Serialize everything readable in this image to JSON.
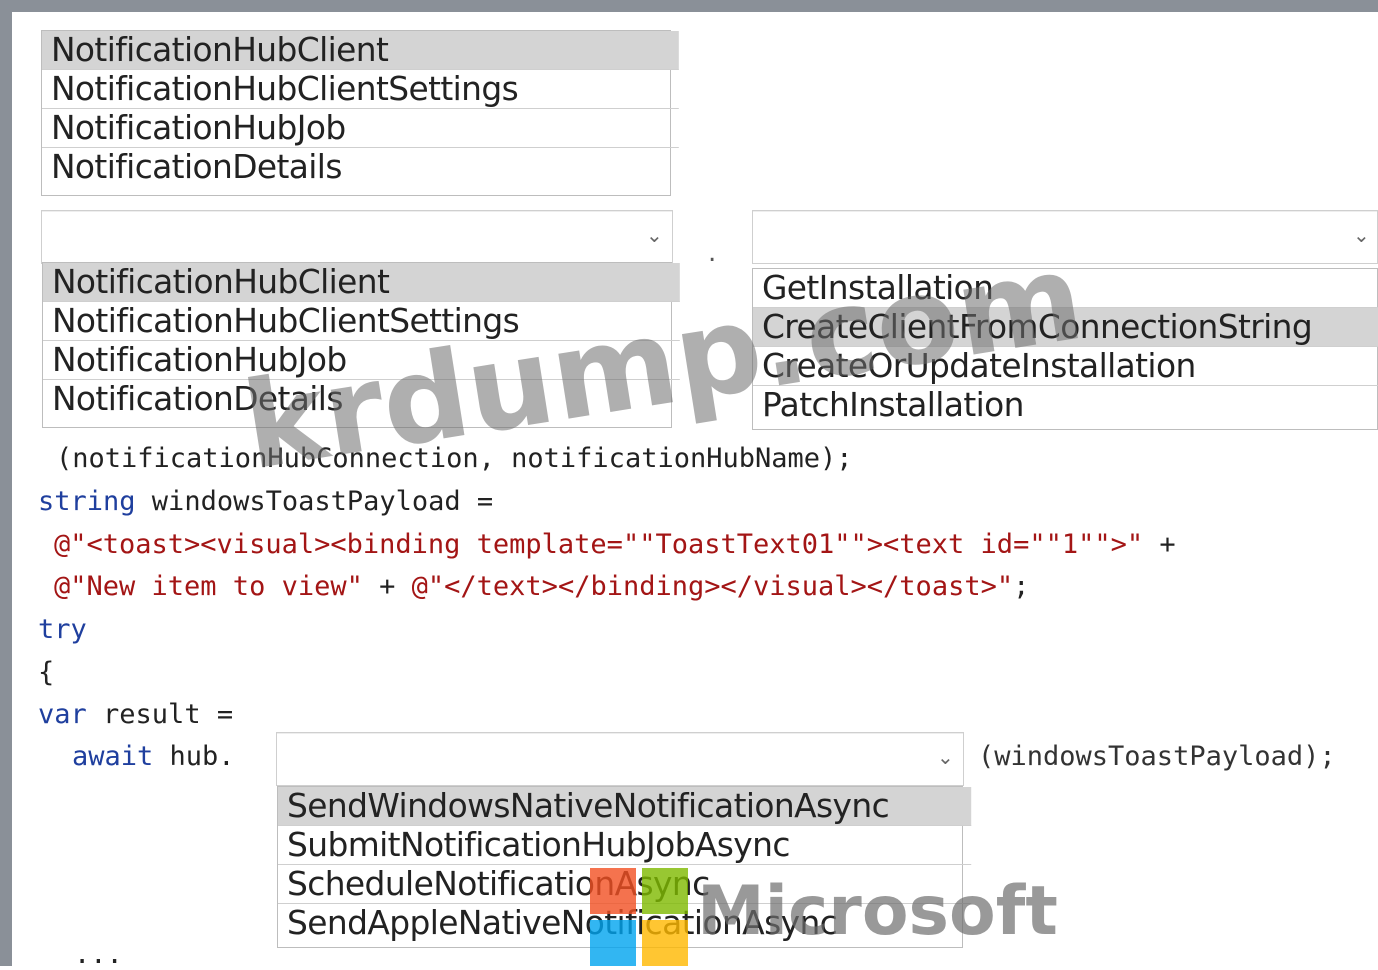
{
  "dropdown1": {
    "options": [
      "NotificationHubClient",
      "NotificationHubClientSettings",
      "NotificationHubJob",
      "NotificationDetails"
    ],
    "selected_index": 0
  },
  "dropdown2": {
    "options": [
      "NotificationHubClient",
      "NotificationHubClientSettings",
      "NotificationHubJob",
      "NotificationDetails"
    ],
    "selected_index": 0
  },
  "dot_separator": ".",
  "dropdown3": {
    "options": [
      "GetInstallation",
      "CreateClientFromConnectionString",
      "CreateOrUpdateInstallation",
      "PatchInstallation"
    ],
    "selected_index": 1
  },
  "dropdown4": {
    "options": [
      "SendWindowsNativeNotificationAsync",
      "SubmitNotificationHubJobAsync",
      "ScheduleNotificationAsync",
      "SendAppleNativeNotificationAsync"
    ],
    "selected_index": 0
  },
  "code": {
    "line_args": "(notificationHubConnection, notificationHubName);",
    "line2_kw": "string",
    "line2_rest": " windowsToastPayload =",
    "line3_str": "@\"<toast><visual><binding template=\"\"ToastText01\"\"><text id=\"\"1\"\">\"",
    "line3_rest": " +",
    "line4_str1": "@\"New item to view\"",
    "line4_mid": " + ",
    "line4_str2": "@\"</text></binding></visual></toast>\"",
    "line4_end": ";",
    "line5_kw": "try",
    "line6": "{",
    "line7_kw": "var",
    "line7_rest": " result =",
    "line8_kw": "await",
    "line8_rest": " hub.",
    "line8_args": "(windowsToastPayload);",
    "line9": "..."
  },
  "watermark": "krdump.com",
  "microsoft_logo_text": "Microsoft",
  "colors": {
    "keyword": "#1f3f9e",
    "string": "#a31515",
    "selected_option": "#d4d4d4",
    "frame": "#8a9098"
  }
}
